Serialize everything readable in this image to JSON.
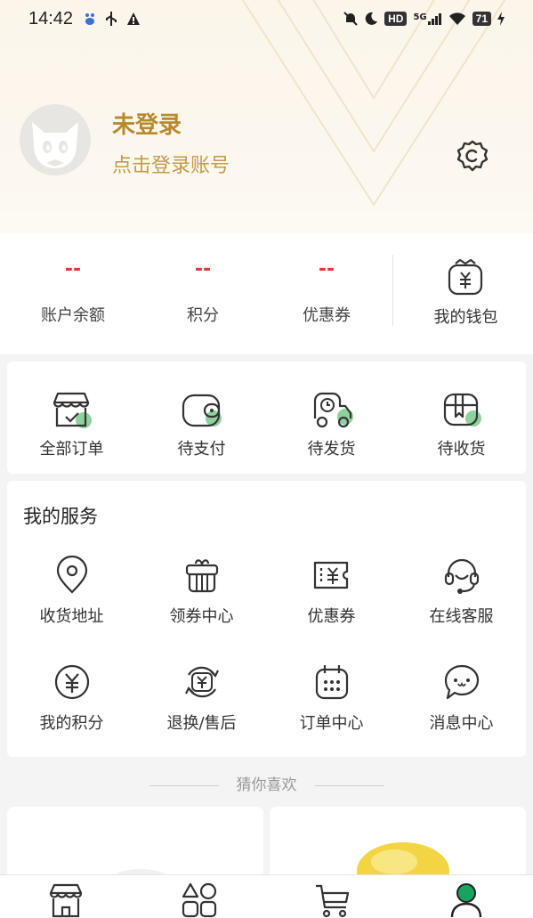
{
  "status_bar": {
    "time": "14:42",
    "battery": "71",
    "signal": "5G",
    "hd": "HD",
    "icons_left": [
      "baidu-icon",
      "usb-icon",
      "warning-icon"
    ],
    "icons_right": [
      "mute-icon",
      "moon-icon",
      "hd-icon",
      "signal-icon",
      "wifi-icon",
      "battery-icon",
      "charging-icon"
    ]
  },
  "profile": {
    "name": "未登录",
    "login_hint": "点击登录账号"
  },
  "stats": [
    {
      "value": "--",
      "label": "账户余额"
    },
    {
      "value": "--",
      "label": "积分"
    },
    {
      "value": "--",
      "label": "优惠券"
    }
  ],
  "wallet": {
    "label": "我的钱包"
  },
  "orders": [
    {
      "label": "全部订单",
      "icon": "shop-order-icon"
    },
    {
      "label": "待支付",
      "icon": "wallet-pay-icon"
    },
    {
      "label": "待发货",
      "icon": "delivery-truck-icon"
    },
    {
      "label": "待收货",
      "icon": "package-receive-icon"
    }
  ],
  "services": {
    "title": "我的服务",
    "items": [
      {
        "label": "收货地址",
        "icon": "location-pin-icon"
      },
      {
        "label": "领券中心",
        "icon": "gift-box-icon"
      },
      {
        "label": "优惠券",
        "icon": "coupon-icon"
      },
      {
        "label": "在线客服",
        "icon": "headset-icon"
      },
      {
        "label": "我的积分",
        "icon": "yen-coin-icon"
      },
      {
        "label": "退换/售后",
        "icon": "refund-icon"
      },
      {
        "label": "订单中心",
        "icon": "calendar-icon"
      },
      {
        "label": "消息中心",
        "icon": "message-bubble-icon"
      }
    ]
  },
  "guess": {
    "title": "猜你喜欢"
  },
  "tabbar": [
    {
      "name": "home-shop-icon",
      "active": false
    },
    {
      "name": "category-grid-icon",
      "active": false
    },
    {
      "name": "cart-icon",
      "active": false
    },
    {
      "name": "profile-icon",
      "active": true
    }
  ],
  "colors": {
    "accent_gold": "#b8892e",
    "price_red": "#e4393c",
    "badge_green": "#8fd19e",
    "tab_active_green": "#1aa260"
  }
}
